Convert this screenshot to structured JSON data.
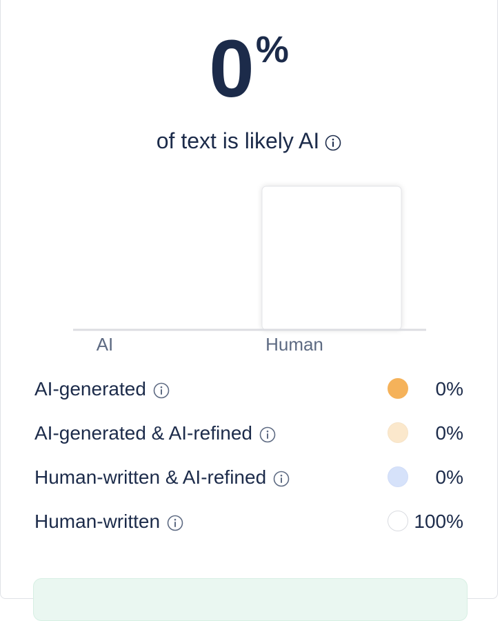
{
  "score": {
    "value": "0",
    "unit": "%"
  },
  "subtitle": "of text is likely AI",
  "chart_data": {
    "type": "bar",
    "categories": [
      "AI",
      "Human"
    ],
    "values": [
      0,
      100
    ],
    "ylim": [
      0,
      100
    ],
    "colors": [
      "#f5b25a",
      "#ffffff"
    ]
  },
  "legend": [
    {
      "label": "AI-generated",
      "value": "0%",
      "color": "#f5b25a",
      "border": "#f5b25a"
    },
    {
      "label": "AI-generated & AI-refined",
      "value": "0%",
      "color": "#fbe8cc",
      "border": "#f6e3c7"
    },
    {
      "label": "Human-written & AI-refined",
      "value": "0%",
      "color": "#d6e2fa",
      "border": "#d0dcf7"
    },
    {
      "label": "Human-written",
      "value": "100%",
      "color": "#ffffff",
      "border": "#d9dbe0"
    }
  ],
  "colors": {
    "text": "#1c2b4a",
    "banner": "#eaf7f1"
  }
}
